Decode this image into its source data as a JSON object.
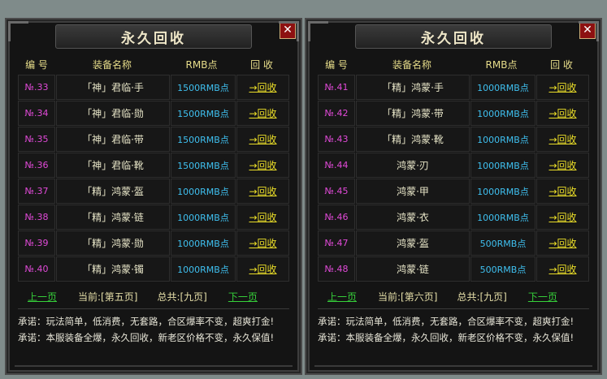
{
  "left": {
    "title": "永久回收",
    "close": "✕",
    "headers": {
      "no": "编 号",
      "name": "装备名称",
      "rmb": "RMB点",
      "action": "回 收"
    },
    "rows": [
      {
        "no": "№.33",
        "name": "「神」君临·手",
        "rmb": "1500RMB点",
        "action": "→回收"
      },
      {
        "no": "№.34",
        "name": "「神」君临·勋",
        "rmb": "1500RMB点",
        "action": "→回收"
      },
      {
        "no": "№.35",
        "name": "「神」君临·带",
        "rmb": "1500RMB点",
        "action": "→回收"
      },
      {
        "no": "№.36",
        "name": "「神」君临·靴",
        "rmb": "1500RMB点",
        "action": "→回收"
      },
      {
        "no": "№.37",
        "name": "「精」鸿蒙·盔",
        "rmb": "1000RMB点",
        "action": "→回收"
      },
      {
        "no": "№.38",
        "name": "「精」鸿蒙·链",
        "rmb": "1000RMB点",
        "action": "→回收"
      },
      {
        "no": "№.39",
        "name": "「精」鸿蒙·勋",
        "rmb": "1000RMB点",
        "action": "→回收"
      },
      {
        "no": "№.40",
        "name": "「精」鸿蒙·镯",
        "rmb": "1000RMB点",
        "action": "→回收"
      }
    ],
    "prev": "上一页",
    "current": "当前:[第五页]",
    "total": "总共:[九页]",
    "next": "下一页",
    "promise1": "承诺：玩法简单，低消费，无套路，合区爆率不变，超爽打金!",
    "promise2": "承诺：本服装备全爆，永久回收，新老区价格不变，永久保值!"
  },
  "right": {
    "title": "永久回收",
    "close": "✕",
    "headers": {
      "no": "编 号",
      "name": "装备名称",
      "rmb": "RMB点",
      "action": "回 收"
    },
    "rows": [
      {
        "no": "№.41",
        "name": "「精」鸿蒙·手",
        "rmb": "1000RMB点",
        "action": "→回收"
      },
      {
        "no": "№.42",
        "name": "「精」鸿蒙·带",
        "rmb": "1000RMB点",
        "action": "→回收"
      },
      {
        "no": "№.43",
        "name": "「精」鸿蒙·靴",
        "rmb": "1000RMB点",
        "action": "→回收"
      },
      {
        "no": "№.44",
        "name": "鸿蒙·刃",
        "rmb": "1000RMB点",
        "action": "→回收"
      },
      {
        "no": "№.45",
        "name": "鸿蒙·甲",
        "rmb": "1000RMB点",
        "action": "→回收"
      },
      {
        "no": "№.46",
        "name": "鸿蒙·衣",
        "rmb": "1000RMB点",
        "action": "→回收"
      },
      {
        "no": "№.47",
        "name": "鸿蒙·盔",
        "rmb": "500RMB点",
        "action": "→回收"
      },
      {
        "no": "№.48",
        "name": "鸿蒙·链",
        "rmb": "500RMB点",
        "action": "→回收"
      }
    ],
    "prev": "上一页",
    "current": "当前:[第六页]",
    "total": "总共:[九页]",
    "next": "下一页",
    "promise1": "承诺：玩法简单，低消费，无套路，合区爆率不变，超爽打金!",
    "promise2": "承诺：本服装备全爆，永久回收，新老区价格不变，永久保值!"
  }
}
